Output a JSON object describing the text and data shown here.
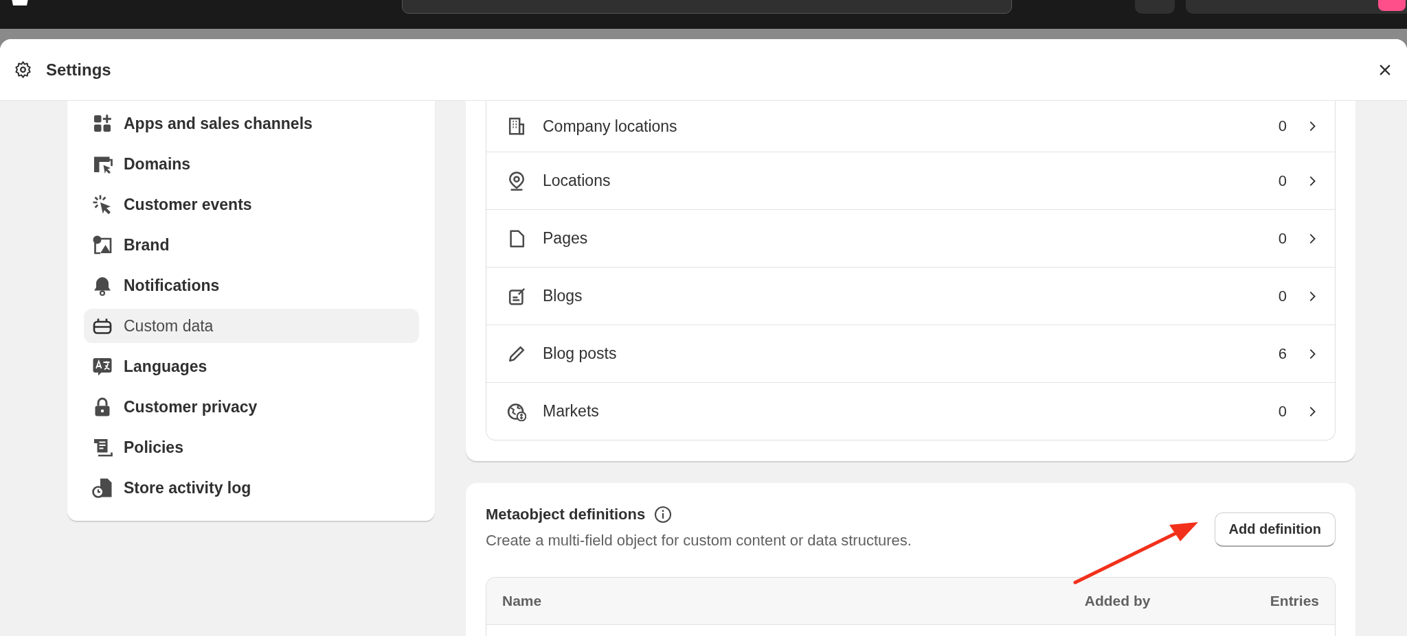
{
  "window": {
    "title": "Settings"
  },
  "sidebar": {
    "items": [
      {
        "label": "Apps and sales channels",
        "selected": false
      },
      {
        "label": "Domains",
        "selected": false
      },
      {
        "label": "Customer events",
        "selected": false
      },
      {
        "label": "Brand",
        "selected": false
      },
      {
        "label": "Notifications",
        "selected": false
      },
      {
        "label": "Custom data",
        "selected": true
      },
      {
        "label": "Languages",
        "selected": false
      },
      {
        "label": "Customer privacy",
        "selected": false
      },
      {
        "label": "Policies",
        "selected": false
      },
      {
        "label": "Store activity log",
        "selected": false
      }
    ]
  },
  "metafield_list": [
    {
      "label": "Company locations",
      "count": "0"
    },
    {
      "label": "Locations",
      "count": "0"
    },
    {
      "label": "Pages",
      "count": "0"
    },
    {
      "label": "Blogs",
      "count": "0"
    },
    {
      "label": "Blog posts",
      "count": "6"
    },
    {
      "label": "Markets",
      "count": "0"
    }
  ],
  "metaobjects": {
    "title": "Metaobject definitions",
    "description": "Create a multi-field object for custom content or data structures.",
    "button": "Add definition",
    "table": {
      "columns": [
        {
          "label": "Name"
        },
        {
          "label": "Added by"
        },
        {
          "label": "Entries"
        }
      ]
    }
  }
}
